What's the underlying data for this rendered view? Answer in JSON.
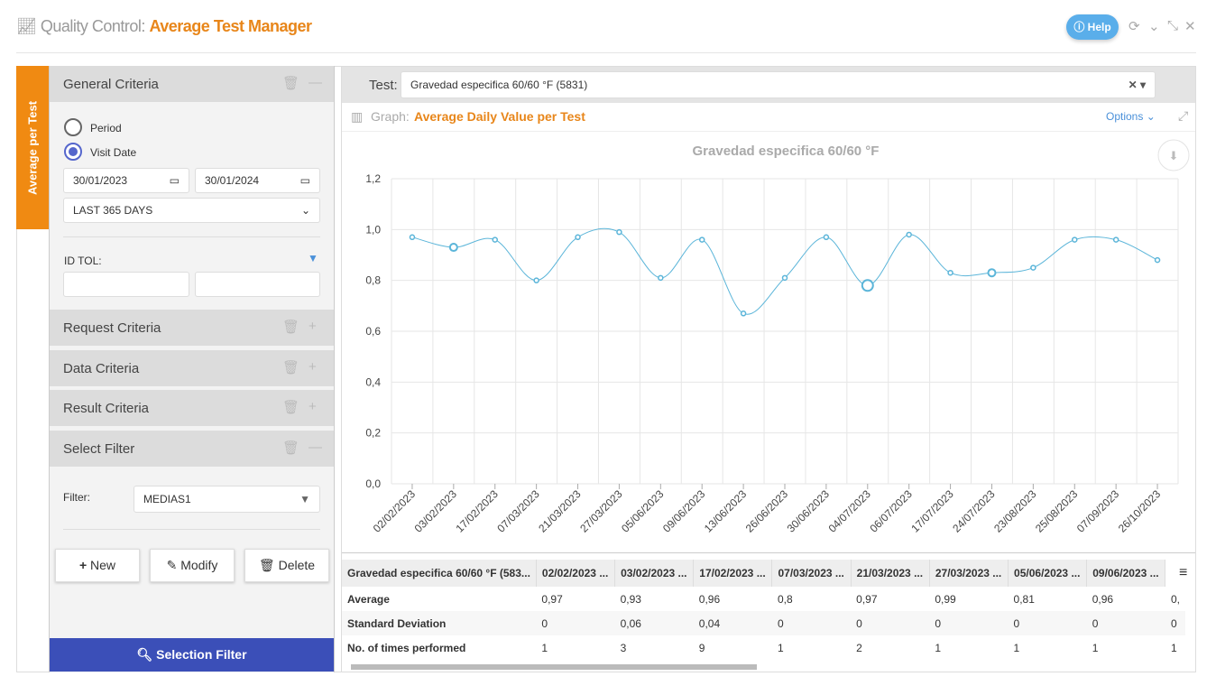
{
  "header": {
    "prefix": "Quality Control:",
    "title": "Average Test Manager",
    "help": "Help",
    "icons": [
      "line-chart-icon",
      "refresh-icon",
      "chevron-down-icon",
      "compress-icon",
      "close-icon"
    ]
  },
  "side_tab": {
    "label": "Average per Test"
  },
  "left": {
    "general": {
      "title": "General Criteria",
      "period": "Period",
      "visit_date": "Visit Date",
      "selected": "Visit Date",
      "date_from": "30/01/2023",
      "date_to": "30/01/2024",
      "range": "LAST 365 DAYS",
      "id_tol": "ID TOL:",
      "id_from": "",
      "id_to": ""
    },
    "request": "Request Criteria",
    "data": "Data Criteria",
    "result": "Result Criteria",
    "select_filter": {
      "title": "Select Filter",
      "filter_label": "Filter:",
      "filter_value": "MEDIAS1"
    },
    "buttons": {
      "new": "New",
      "modify": "Modify",
      "delete": "Delete"
    },
    "selection_filter": "Selection Filter"
  },
  "right": {
    "test_label": "Test:",
    "test_value": "Gravedad especifica 60/60 °F (5831)",
    "graph_label": "Graph:",
    "graph_title": "Average Daily Value per Test",
    "options": "Options"
  },
  "colors": {
    "accent": "#e8861a",
    "primary": "#3b4fb8",
    "series": "#5bb5d9",
    "help": "#5aaeea"
  },
  "chart_data": {
    "type": "line",
    "title": "Gravedad especifica 60/60 °F",
    "categories": [
      "02/02/2023",
      "03/02/2023",
      "17/02/2023",
      "07/03/2023",
      "21/03/2023",
      "27/03/2023",
      "05/06/2023",
      "09/06/2023",
      "13/06/2023",
      "26/06/2023",
      "30/06/2023",
      "04/07/2023",
      "06/07/2023",
      "17/07/2023",
      "24/07/2023",
      "23/08/2023",
      "25/08/2023",
      "07/09/2023",
      "26/10/2023"
    ],
    "values": [
      0.97,
      0.93,
      0.96,
      0.8,
      0.97,
      0.99,
      0.81,
      0.96,
      0.67,
      0.81,
      0.97,
      0.78,
      0.98,
      0.83,
      0.83,
      0.85,
      0.96,
      0.96,
      0.88
    ],
    "ylim": [
      0,
      1.2
    ],
    "yticks": [
      "0,0",
      "0,2",
      "0,4",
      "0,6",
      "0,8",
      "1,0",
      "1,2"
    ],
    "grid": true,
    "smooth": true
  },
  "table": {
    "headers": [
      "Gravedad especifica 60/60 °F (583...",
      "02/02/2023 ...",
      "03/02/2023 ...",
      "17/02/2023 ...",
      "07/03/2023 ...",
      "21/03/2023 ...",
      "27/03/2023 ...",
      "05/06/2023 ...",
      "09/06/2023 ..."
    ],
    "rows": [
      {
        "label": "Average",
        "values": [
          "0,97",
          "0,93",
          "0,96",
          "0,8",
          "0,97",
          "0,99",
          "0,81",
          "0,96",
          "0,"
        ]
      },
      {
        "label": "Standard Deviation",
        "values": [
          "0",
          "0,06",
          "0,04",
          "0",
          "0",
          "0",
          "0",
          "0",
          "0"
        ]
      },
      {
        "label": "No. of times performed",
        "values": [
          "1",
          "3",
          "9",
          "1",
          "2",
          "1",
          "1",
          "1",
          "1"
        ]
      }
    ]
  }
}
